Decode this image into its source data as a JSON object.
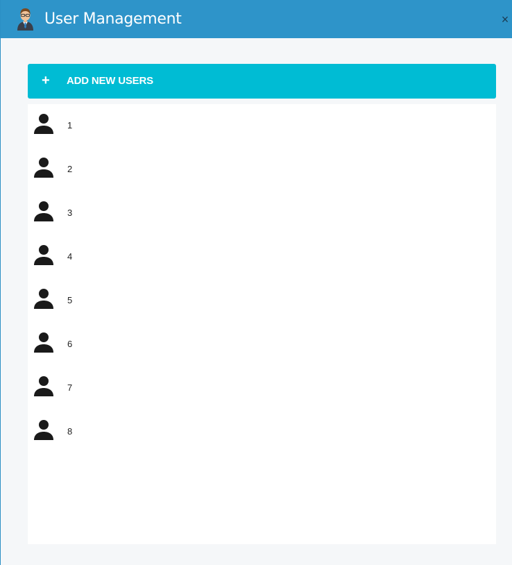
{
  "window": {
    "title": "User Management",
    "close_symbol": "×",
    "title_icon": "user-management-icon"
  },
  "toolbar": {
    "add_icon": "plus-icon",
    "add_symbol": "+",
    "add_label": "ADD NEW USERS"
  },
  "users": [
    {
      "label": "1",
      "icon": "person-icon"
    },
    {
      "label": "2",
      "icon": "person-icon"
    },
    {
      "label": "3",
      "icon": "person-icon"
    },
    {
      "label": "4",
      "icon": "person-icon"
    },
    {
      "label": "5",
      "icon": "person-icon"
    },
    {
      "label": "6",
      "icon": "person-icon"
    },
    {
      "label": "7",
      "icon": "person-icon"
    },
    {
      "label": "8",
      "icon": "person-icon"
    }
  ],
  "colors": {
    "titlebar": "#2e94c9",
    "accent": "#00bcd4",
    "background": "#f5f7f9",
    "list_background": "#ffffff",
    "icon": "#1a1a1a"
  }
}
